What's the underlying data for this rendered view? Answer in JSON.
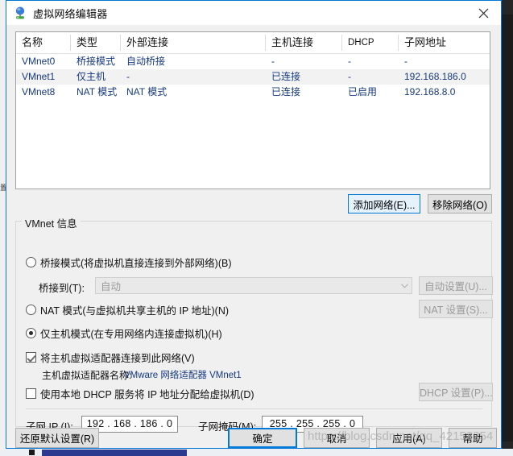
{
  "window": {
    "title": "虚拟网络编辑器",
    "icon": "virtual-network-icon",
    "close_label": "✕"
  },
  "table": {
    "columns": [
      {
        "label": "名称"
      },
      {
        "label": "类型"
      },
      {
        "label": "外部连接"
      },
      {
        "label": "主机连接"
      },
      {
        "label": "DHCP"
      },
      {
        "label": "子网地址"
      }
    ],
    "rows": [
      {
        "name": "VMnet0",
        "type": "桥接模式",
        "external": "自动桥接",
        "host": "-",
        "dhcp": "-",
        "subnet": "-",
        "selected": false
      },
      {
        "name": "VMnet1",
        "type": "仅主机",
        "external": "-",
        "host": "已连接",
        "dhcp": "-",
        "subnet": "192.168.186.0",
        "selected": true
      },
      {
        "name": "VMnet8",
        "type": "NAT 模式",
        "external": "NAT 模式",
        "host": "已连接",
        "dhcp": "已启用",
        "subnet": "192.168.8.0",
        "selected": false
      }
    ]
  },
  "list_actions": {
    "add_network": "添加网络(E)...",
    "remove_network": "移除网络(O)"
  },
  "vmnet_info": {
    "legend": "VMnet 信息",
    "mode_bridged": "桥接模式(将虚拟机直接连接到外部网络)(B)",
    "bridged_to_label": "桥接到(T):",
    "bridged_to_value": "自动",
    "auto_settings": "自动设置(U)...",
    "mode_nat": "NAT 模式(与虚拟机共享主机的 IP 地址)(N)",
    "nat_settings": "NAT 设置(S)...",
    "mode_hostonly": "仅主机模式(在专用网络内连接虚拟机)(H)",
    "connect_adapter": "将主机虚拟适配器连接到此网络(V)",
    "adapter_name_label": "主机虚拟适配器名称:",
    "adapter_name_value": "VMware 网络适配器 VMnet1",
    "use_dhcp": "使用本地 DHCP 服务将 IP 地址分配给虚拟机(D)",
    "dhcp_settings": "DHCP 设置(P)...",
    "subnet_ip_label": "子网 IP (I):",
    "subnet_ip_value": "192 . 168 . 186 .  0",
    "subnet_mask_label": "子网掩码(M):",
    "subnet_mask_value": "255 . 255 . 255 .  0",
    "selected_mode": "hostonly",
    "connect_adapter_checked": true,
    "use_dhcp_checked": false
  },
  "footer": {
    "restore_defaults": "还原默认设置(R)",
    "ok": "确定",
    "cancel": "取消",
    "apply": "应用(A)",
    "help": "帮助"
  },
  "overlay": {
    "watermark": "https://blog.csdn.net/qq_42153254"
  },
  "background": {
    "left_text": "置管机虚"
  },
  "colors": {
    "accent": "#0078d7",
    "row_text": "#16397f",
    "selected_row": "#f2f2f2",
    "dialog_bg": "#f0f0f0"
  }
}
